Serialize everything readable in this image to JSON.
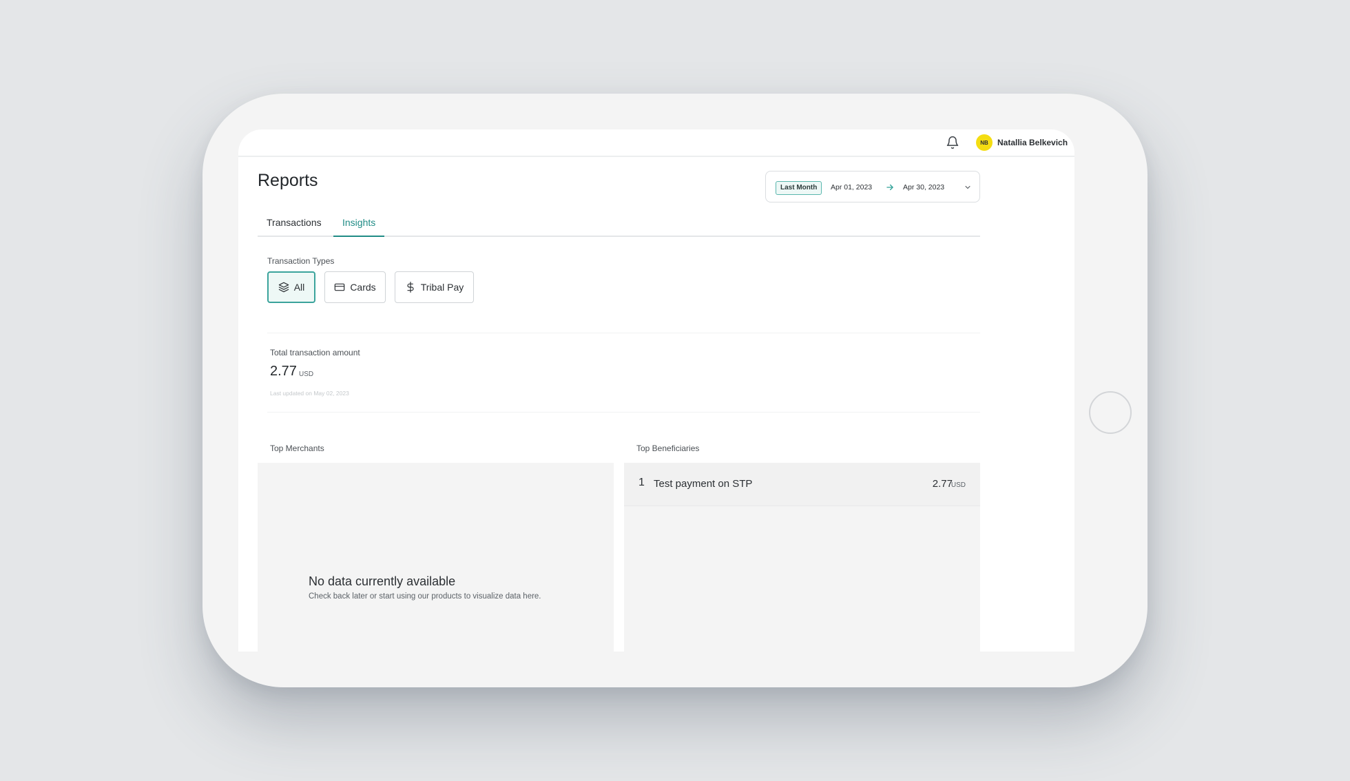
{
  "header": {
    "user_initials": "NB",
    "user_name": "Natallia Belkevich"
  },
  "page": {
    "title": "Reports"
  },
  "date_filter": {
    "period": "Last Month",
    "start": "Apr 01, 2023",
    "end": "Apr 30, 2023"
  },
  "tabs": [
    {
      "label": "Transactions",
      "active": false
    },
    {
      "label": "Insights",
      "active": true
    }
  ],
  "transaction_types": {
    "label": "Transaction Types",
    "options": [
      {
        "label": "All",
        "icon": "layers-icon",
        "selected": true
      },
      {
        "label": "Cards",
        "icon": "credit-card-icon",
        "selected": false
      },
      {
        "label": "Tribal Pay",
        "icon": "dollar-icon",
        "selected": false
      }
    ]
  },
  "total": {
    "label": "Total transaction amount",
    "amount": "2.77",
    "currency": "USD",
    "updated": "Last updated on May 02, 2023"
  },
  "top_merchants": {
    "title": "Top Merchants",
    "empty_title": "No data currently available",
    "empty_subtitle": "Check back later or start using our products to visualize data here."
  },
  "top_beneficiaries": {
    "title": "Top Beneficiaries",
    "items": [
      {
        "rank": "1",
        "name": "Test payment on STP",
        "amount": "2.77",
        "currency": "USD"
      }
    ]
  },
  "colors": {
    "accent": "#1f8b85",
    "avatar": "#f4dd12",
    "background": "#e4e6e8"
  }
}
